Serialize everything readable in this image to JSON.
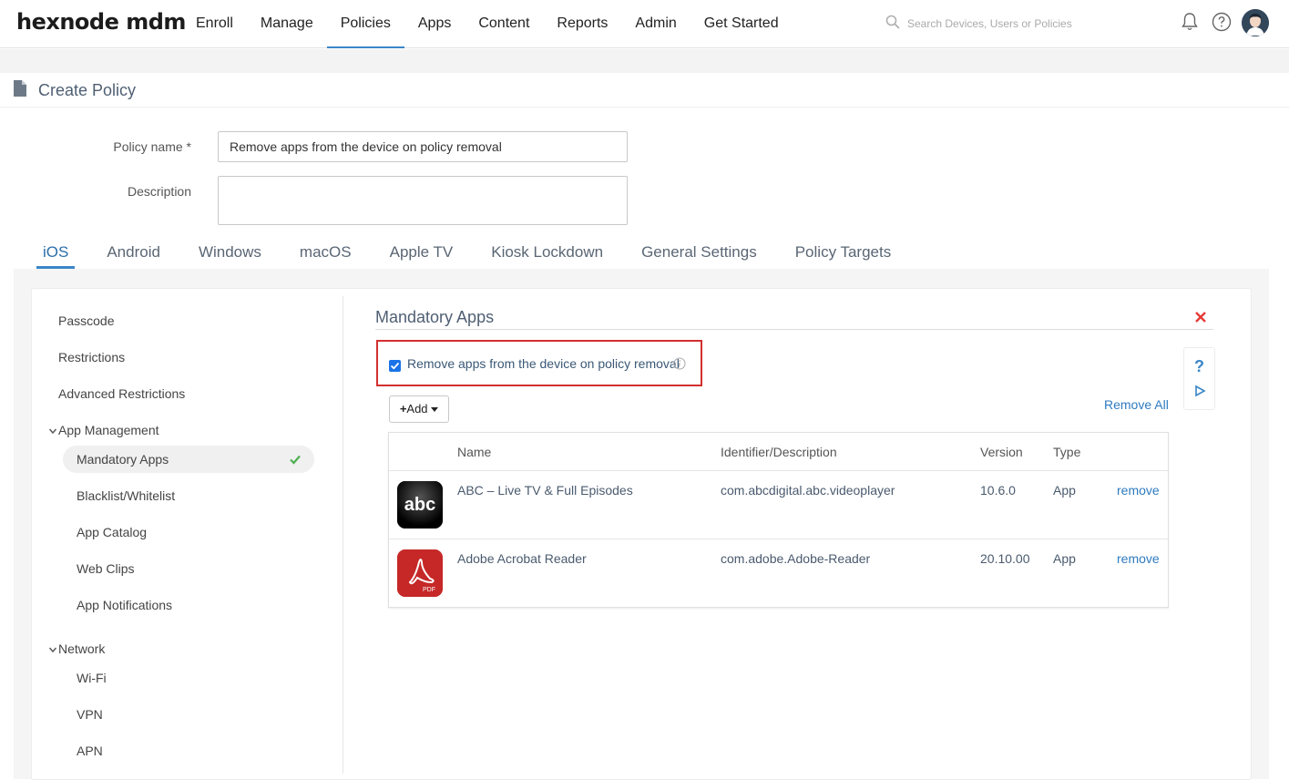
{
  "brand": {
    "logo_text": "hexnode mdm"
  },
  "nav": {
    "items": [
      {
        "label": "Enroll"
      },
      {
        "label": "Manage"
      },
      {
        "label": "Policies"
      },
      {
        "label": "Apps"
      },
      {
        "label": "Content"
      },
      {
        "label": "Reports"
      },
      {
        "label": "Admin"
      },
      {
        "label": "Get Started"
      }
    ],
    "active": "Policies"
  },
  "search": {
    "placeholder": "Search Devices, Users or Policies"
  },
  "page": {
    "title": "Create Policy"
  },
  "form": {
    "policy_name_label": "Policy name *",
    "policy_name_value": "Remove apps from the device on policy removal",
    "description_label": "Description",
    "description_value": ""
  },
  "os_tabs": {
    "items": [
      {
        "label": "iOS"
      },
      {
        "label": "Android"
      },
      {
        "label": "Windows"
      },
      {
        "label": "macOS"
      },
      {
        "label": "Apple TV"
      },
      {
        "label": "Kiosk Lockdown"
      },
      {
        "label": "General Settings"
      },
      {
        "label": "Policy Targets"
      }
    ],
    "active": "iOS"
  },
  "sidebar": {
    "items": [
      {
        "label": "Passcode"
      },
      {
        "label": "Restrictions"
      },
      {
        "label": "Advanced Restrictions"
      }
    ],
    "groups": [
      {
        "label": "App Management",
        "items": [
          {
            "label": "Mandatory Apps",
            "active": true,
            "configured": true
          },
          {
            "label": "Blacklist/Whitelist"
          },
          {
            "label": "App Catalog"
          },
          {
            "label": "Web Clips"
          },
          {
            "label": "App Notifications"
          }
        ]
      },
      {
        "label": "Network",
        "items": [
          {
            "label": "Wi-Fi"
          },
          {
            "label": "VPN"
          },
          {
            "label": "APN"
          }
        ]
      }
    ]
  },
  "content": {
    "section_title": "Mandatory Apps",
    "remove_checkbox_label": "Remove apps from the device on policy removal",
    "remove_checkbox_checked": true,
    "add_button_label": "Add",
    "remove_all_label": "Remove All",
    "help_symbol": "?"
  },
  "table": {
    "columns": [
      "Name",
      "Identifier/Description",
      "Version",
      "Type"
    ],
    "rows": [
      {
        "icon": "abc-app-icon",
        "name": "ABC – Live TV & Full Episodes",
        "identifier": "com.abcdigital.abc.videoplayer",
        "version": "10.6.0",
        "type": "App",
        "action": "remove",
        "icon_text": "abc"
      },
      {
        "icon": "adobe-acrobat-icon",
        "name": "Adobe Acrobat Reader",
        "identifier": "com.adobe.Adobe-Reader",
        "version": "20.10.00",
        "type": "App",
        "action": "remove",
        "icon_text": "PDF"
      }
    ]
  },
  "colors": {
    "accent": "#3a86c8",
    "link": "#2f7bbf",
    "highlight_border": "#d32f2f",
    "check_green": "#4caf50",
    "close_red": "#e53935"
  }
}
